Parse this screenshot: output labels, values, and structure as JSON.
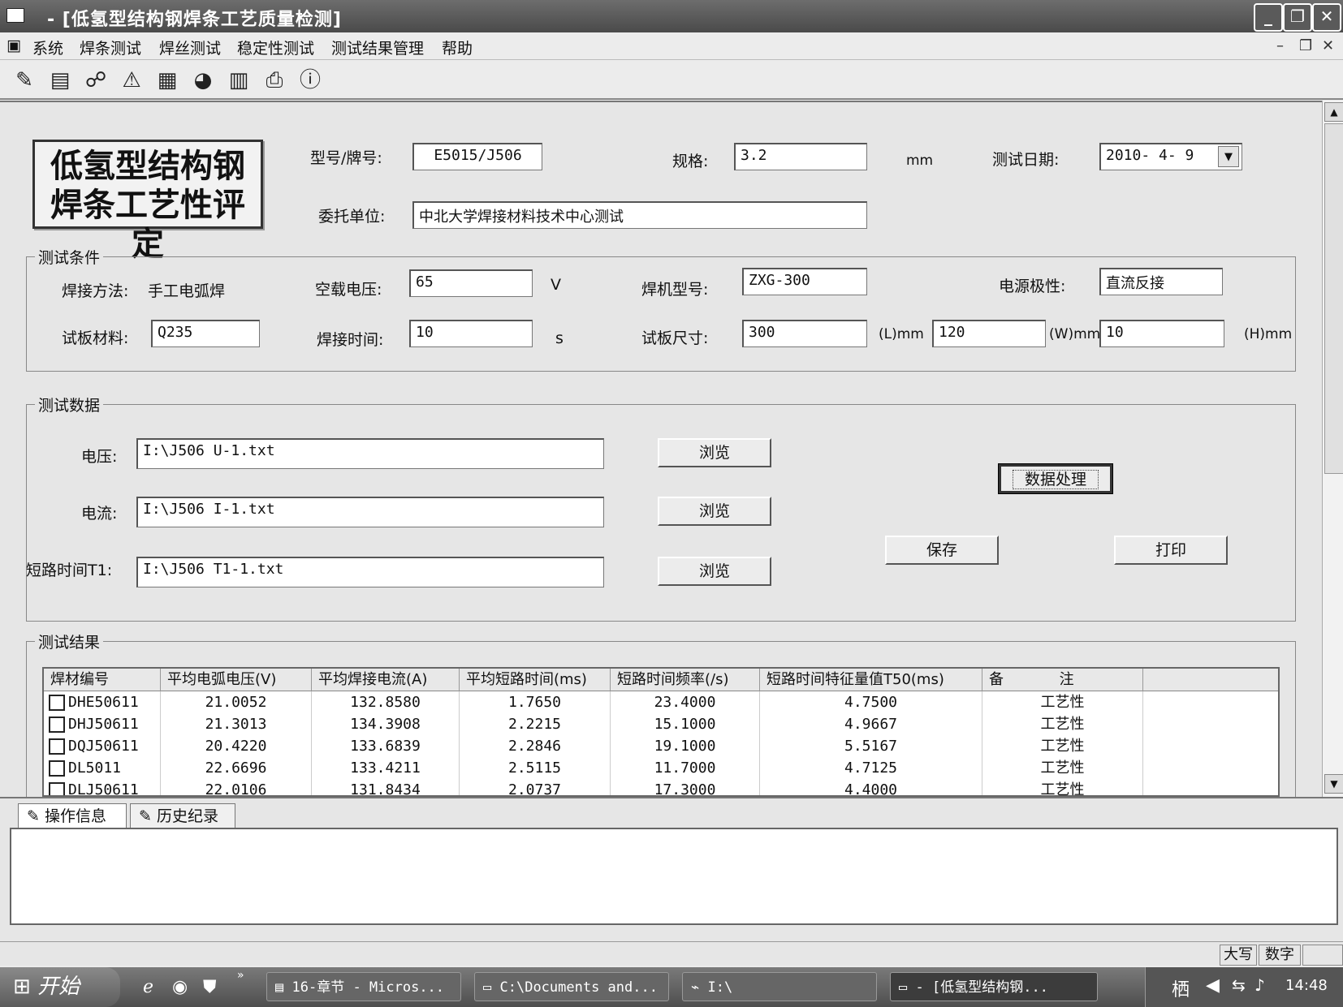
{
  "window": {
    "title": "- [低氢型结构钢焊条工艺质量检测]"
  },
  "menu": [
    "系统",
    "焊条测试",
    "焊丝测试",
    "稳定性测试",
    "测试结果管理",
    "帮助"
  ],
  "toolbar_icons": [
    "edit-icon",
    "open-icon",
    "link-icon",
    "measure-icon",
    "analysis-icon",
    "chart-icon",
    "report-icon",
    "print-icon",
    "info-icon"
  ],
  "header": {
    "logo_line1": "低氢型结构钢",
    "logo_line2": "焊条工艺性评定",
    "model_label": "型号/牌号:",
    "model_value": "E5015/J506",
    "spec_label": "规格:",
    "spec_value": "3.2",
    "spec_unit": "mm",
    "date_label": "测试日期:",
    "date_value": "2010- 4- 9",
    "client_label": "委托单位:",
    "client_value": "中北大学焊接材料技术中心测试"
  },
  "conditions": {
    "title": "测试条件",
    "method_label": "焊接方法:",
    "method_value": "手工电弧焊",
    "noload_label": "空载电压:",
    "noload_value": "65",
    "noload_unit": "V",
    "machine_label": "焊机型号:",
    "machine_value": "ZXG-300",
    "polarity_label": "电源极性:",
    "polarity_value": "直流反接",
    "plate_label": "试板材料:",
    "plate_value": "Q235",
    "time_label": "焊接时间:",
    "time_value": "10",
    "time_unit": "s",
    "size_label": "试板尺寸:",
    "size_l": "300",
    "size_l_unit": "(L)mm",
    "size_w": "120",
    "size_w_unit": "(W)mm",
    "size_h": "10",
    "size_h_unit": "(H)mm"
  },
  "testdata": {
    "title": "测试数据",
    "voltage_label": "电压:",
    "voltage_file": "I:\\J506 U-1.txt",
    "current_label": "电流:",
    "current_file": "I:\\J506 I-1.txt",
    "short_label": "短路时间T1:",
    "short_file": "I:\\J506 T1-1.txt",
    "browse": "浏览",
    "process": "数据处理",
    "save": "保存",
    "print": "打印"
  },
  "results": {
    "title": "测试结果",
    "columns": [
      "焊材编号",
      "平均电弧电压(V)",
      "平均焊接电流(A)",
      "平均短路时间(ms)",
      "短路时间频率(/s)",
      "短路时间特征量值T50(ms)",
      "备            注"
    ],
    "rows": [
      [
        "DHE50611",
        "21.0052",
        "132.8580",
        "1.7650",
        "23.4000",
        "4.7500",
        "工艺性"
      ],
      [
        "DHJ50611",
        "21.3013",
        "134.3908",
        "2.2215",
        "15.1000",
        "4.9667",
        "工艺性"
      ],
      [
        "DQJ50611",
        "20.4220",
        "133.6839",
        "2.2846",
        "19.1000",
        "5.5167",
        "工艺性"
      ],
      [
        "DL5011",
        "22.6696",
        "133.4211",
        "2.5115",
        "11.7000",
        "4.7125",
        "工艺性"
      ],
      [
        "DLJ50611",
        "22.0106",
        "131.8434",
        "2.0737",
        "17.3000",
        "4.4000",
        "工艺性"
      ]
    ]
  },
  "log": {
    "tab1": "操作信息",
    "tab2": "历史纪录"
  },
  "status": {
    "caps": "大写",
    "num": "数字"
  },
  "taskbar": {
    "start": "开始",
    "tasks": [
      "16-章节 - Micros...",
      "C:\\Documents and...",
      "I:\\",
      "- [低氢型结构钢..."
    ],
    "ime": "栖",
    "clock": "14:48"
  }
}
